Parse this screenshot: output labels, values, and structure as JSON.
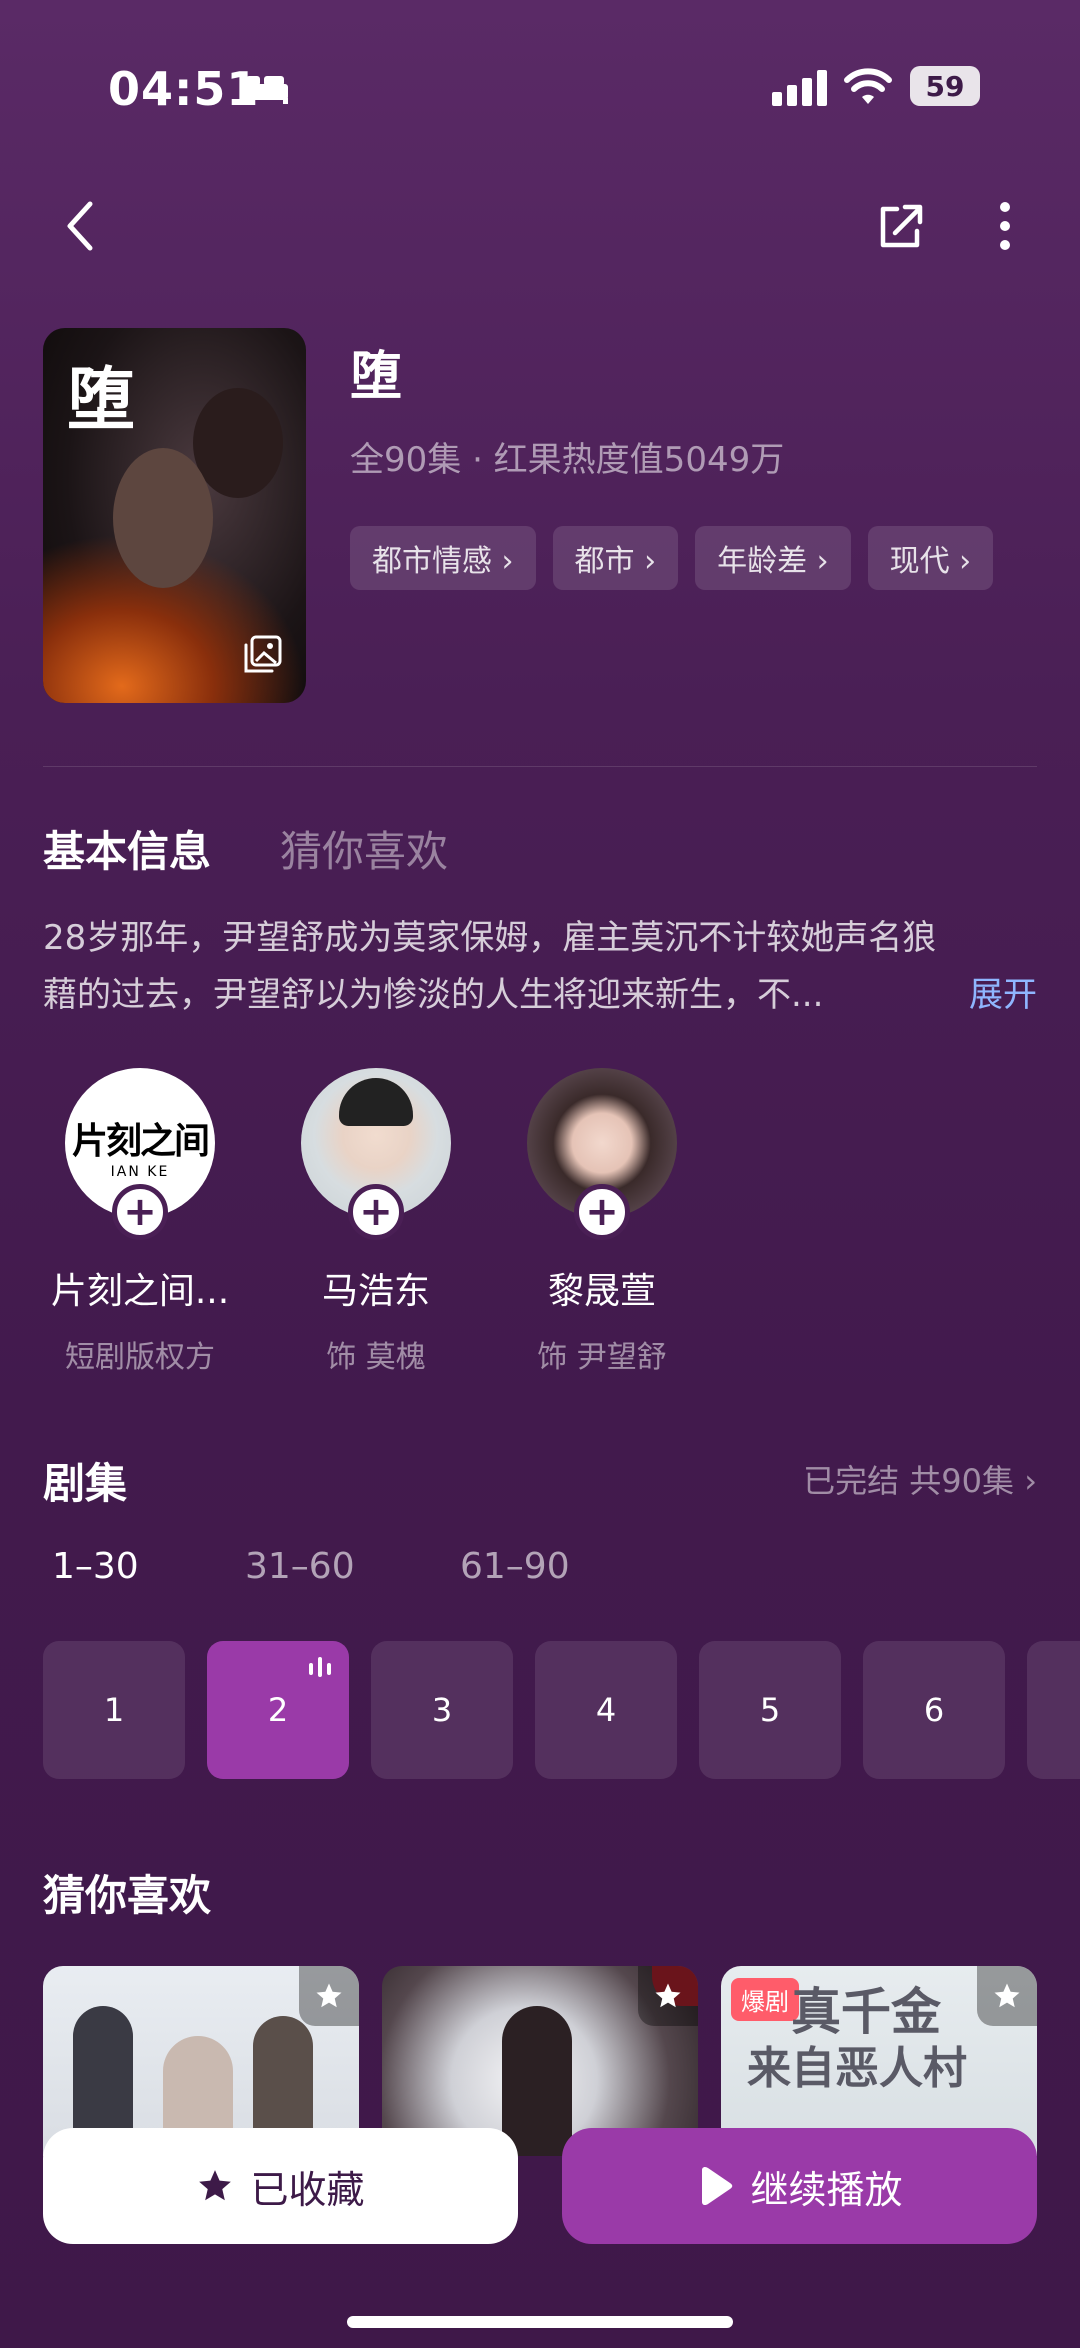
{
  "status": {
    "time": "04:51",
    "battery": "59"
  },
  "show": {
    "title": "堕",
    "meta": "全90集 · 红果热度值5049万",
    "poster_title": "堕",
    "tags": [
      "都市情感 ›",
      "都市 ›",
      "年龄差 ›",
      "现代 ›"
    ]
  },
  "tabs": {
    "info": "基本信息",
    "guess": "猜你喜欢"
  },
  "synopsis": {
    "line1": "28岁那年，尹望舒成为莫家保姆，雇主莫沉不计较她声名狼",
    "line2": "藉的过去，尹望舒以为惨淡的人生将迎来新生，不...",
    "expand": "展开"
  },
  "cast": [
    {
      "name": "片刻之间...",
      "role": "短剧版权方",
      "logo": "片刻之间",
      "logo_sub": "IAN KE"
    },
    {
      "name": "马浩东",
      "role": "饰 莫槐"
    },
    {
      "name": "黎晟萱",
      "role": "饰 尹望舒"
    }
  ],
  "episodes": {
    "title": "剧集",
    "status": "已完结 共90集 ›",
    "ranges": [
      "1–30",
      "31–60",
      "61–90"
    ],
    "items": [
      "1",
      "2",
      "3",
      "4",
      "5",
      "6"
    ],
    "current": "2"
  },
  "recommend": {
    "title": "猜你喜欢",
    "badge": "爆剧",
    "card3_title_1": "真千金",
    "card3_title_2": "来自恶人村"
  },
  "actions": {
    "collected": "已收藏",
    "continue": "继续播放"
  },
  "colors": {
    "accent": "#9a3aa8",
    "link": "#8fb6ff",
    "background": "#4a1f55"
  }
}
